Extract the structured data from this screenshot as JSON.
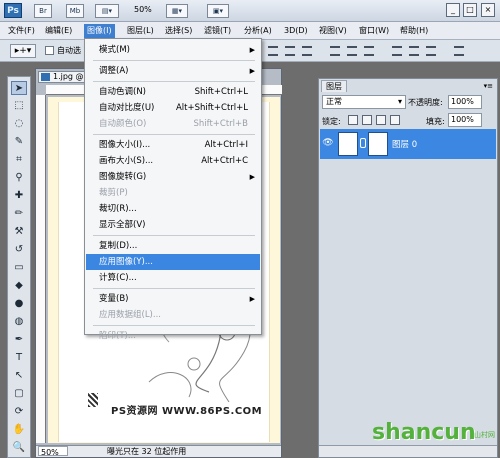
{
  "appbar": {
    "logo": "Ps",
    "br": "Br",
    "mb": "Mb",
    "zoom": "50%"
  },
  "menubar": [
    "文件(F)",
    "编辑(E)",
    "图像(I)",
    "图层(L)",
    "选择(S)",
    "滤镜(T)",
    "分析(A)",
    "3D(D)",
    "视图(V)",
    "窗口(W)",
    "帮助(H)"
  ],
  "options": {
    "auto_select": "自动选"
  },
  "document": {
    "tab": "1.jpg @",
    "watermark": "PS资源网 WWW.86PS.COM",
    "zoom": "50%",
    "status": "曝光只在 32 位起作用"
  },
  "image_menu": [
    {
      "label": "模式(M)",
      "shortcut": "",
      "submenu": true,
      "disabled": false
    },
    {
      "sep": true
    },
    {
      "label": "调整(A)",
      "shortcut": "",
      "submenu": true,
      "disabled": false
    },
    {
      "sep": true
    },
    {
      "label": "自动色调(N)",
      "shortcut": "Shift+Ctrl+L",
      "submenu": false,
      "disabled": false
    },
    {
      "label": "自动对比度(U)",
      "shortcut": "Alt+Shift+Ctrl+L",
      "submenu": false,
      "disabled": false
    },
    {
      "label": "自动颜色(O)",
      "shortcut": "Shift+Ctrl+B",
      "submenu": false,
      "disabled": true
    },
    {
      "sep": true
    },
    {
      "label": "图像大小(I)...",
      "shortcut": "Alt+Ctrl+I",
      "submenu": false,
      "disabled": false
    },
    {
      "label": "画布大小(S)...",
      "shortcut": "Alt+Ctrl+C",
      "submenu": false,
      "disabled": false
    },
    {
      "label": "图像旋转(G)",
      "shortcut": "",
      "submenu": true,
      "disabled": false
    },
    {
      "label": "裁剪(P)",
      "shortcut": "",
      "submenu": false,
      "disabled": true
    },
    {
      "label": "裁切(R)...",
      "shortcut": "",
      "submenu": false,
      "disabled": false
    },
    {
      "label": "显示全部(V)",
      "shortcut": "",
      "submenu": false,
      "disabled": false
    },
    {
      "sep": true
    },
    {
      "label": "复制(D)...",
      "shortcut": "",
      "submenu": false,
      "disabled": false
    },
    {
      "label": "应用图像(Y)...",
      "shortcut": "",
      "submenu": false,
      "disabled": false,
      "highlight": true
    },
    {
      "label": "计算(C)...",
      "shortcut": "",
      "submenu": false,
      "disabled": false
    },
    {
      "sep": true
    },
    {
      "label": "变量(B)",
      "shortcut": "",
      "submenu": true,
      "disabled": false
    },
    {
      "label": "应用数据组(L)...",
      "shortcut": "",
      "submenu": false,
      "disabled": true
    },
    {
      "sep": true
    },
    {
      "label": "陷印(T)...",
      "shortcut": "",
      "submenu": false,
      "disabled": true
    }
  ],
  "layers": {
    "title": "图层",
    "blend_mode": "正常",
    "opacity_label": "不透明度:",
    "opacity": "100%",
    "lock_label": "锁定:",
    "fill_label": "填充:",
    "fill": "100%",
    "layer_name": "图层 0"
  },
  "brand": {
    "name": "shancun",
    "cn": "山村网"
  }
}
